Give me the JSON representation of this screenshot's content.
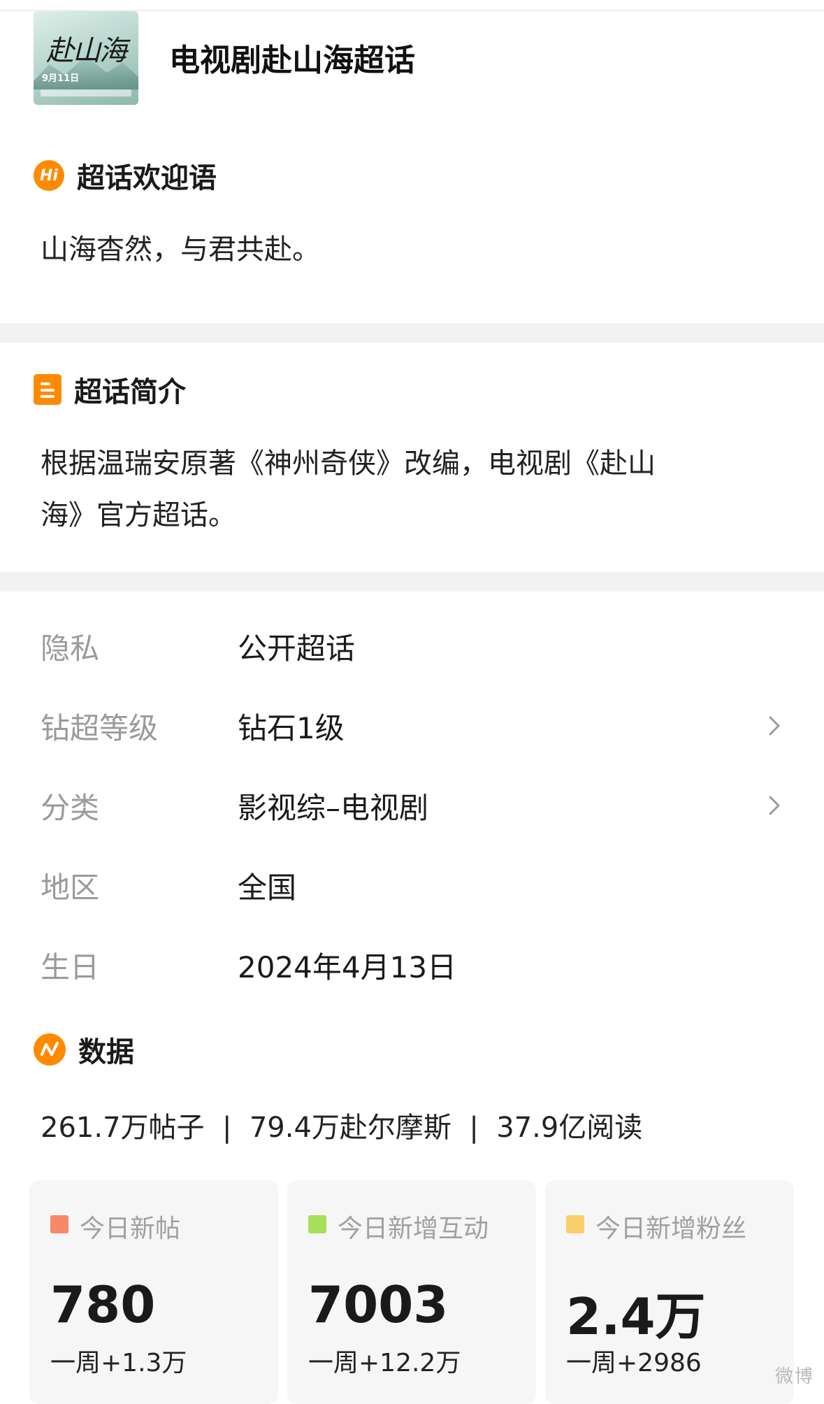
{
  "header": {
    "title": "电视剧赴山海超话",
    "cover": {
      "calligraphy": "赴山海",
      "date": "9月11日"
    }
  },
  "welcome": {
    "heading": "超话欢迎语",
    "icon": "hi-badge-icon",
    "text": "山海杳然，与君共赴。"
  },
  "intro": {
    "heading": "超话简介",
    "icon": "document-icon",
    "line1": "根据温瑞安原著《神州奇侠》改编，电视剧《赴山",
    "line2": "海》官方超话。"
  },
  "info": [
    {
      "key": "隐私",
      "value": "公开超话"
    },
    {
      "key": "钻超等级",
      "value": "钻石1级"
    },
    {
      "key": "分类",
      "value": "影视综–电视剧"
    },
    {
      "key": "地区",
      "value": "全国"
    },
    {
      "key": "生日",
      "value": "2024年4月13日"
    }
  ],
  "data_section": {
    "heading": "数据",
    "icon": "data-trend-icon",
    "summary": "261.7万帖子  |  79.4万赴尔摩斯  |  37.9亿阅读"
  },
  "cards": [
    {
      "label": "今日新帖",
      "value": "780",
      "sub": "一周+1.3万",
      "color": "#f7896a"
    },
    {
      "label": "今日新增互动",
      "value": "7003",
      "sub": "一周+12.2万",
      "color": "#a8de5a"
    },
    {
      "label": "今日新增粉丝",
      "value": "2.4万",
      "sub": "一周+2986",
      "color": "#f9cf6b"
    }
  ],
  "watermark": "微博"
}
